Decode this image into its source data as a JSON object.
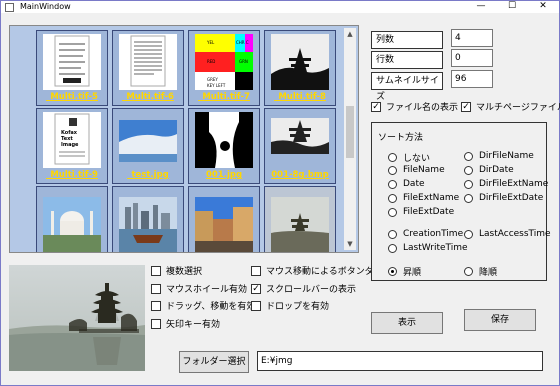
{
  "window": {
    "title": "MainWindow",
    "minimize": "—",
    "maximize": "☐",
    "close": "✕"
  },
  "gallery": {
    "items": [
      "_Multi.tif-5",
      "_Multi.tif-6",
      "_Multi.tif-7",
      "_Multi.tif-8",
      "_Multi.tif-9",
      "_test.jpg",
      "001.jpg",
      "001-8g.bmp",
      "",
      "",
      "",
      ""
    ],
    "thumb7_labels": [
      "YEL",
      "CHR C",
      "RED",
      "GRN",
      "GREY",
      "KEY LEFT"
    ],
    "thumb9_text": [
      "Kofax",
      "Text",
      "Image"
    ]
  },
  "options": {
    "multi_select": "複数選択",
    "mouse_move_down": "マウス移動によるボタンダウン",
    "mouse_wheel": "マウスホイール有効",
    "show_scrollbar": "スクロールバーの表示",
    "drag_move": "ドラッグ、移動を有効",
    "drop": "ドロップを有効",
    "arrow_keys": "矢印キー有効"
  },
  "settings": {
    "columns_label": "列数",
    "columns_value": "4",
    "rows_label": "行数",
    "rows_value": "0",
    "thumb_size_label": "サムネイルサイズ",
    "thumb_size_value": "96",
    "show_filename": "ファイル名の表示",
    "multipage_file": "マルチページファイル"
  },
  "sort": {
    "title": "ソート方法",
    "options_left": [
      "しない",
      "FileName",
      "Date",
      "FileExtName",
      "FileExtDate"
    ],
    "options_right": [
      "DirFileName",
      "DirDate",
      "DirFileExtName",
      "DirFileExtDate"
    ],
    "creation_time": "CreationTime",
    "last_access_time": "LastAccessTime",
    "last_write_time": "LastWriteTime",
    "ascending": "昇順",
    "descending": "降順"
  },
  "buttons": {
    "show": "表示",
    "save": "保存",
    "select_folder": "フォルダー選択"
  },
  "folder_path": "E:¥jmg",
  "colors": {
    "caption": "#ffd700",
    "gallery_bg": "#b4c8e6",
    "tile_bg": "#9fb6d9"
  }
}
